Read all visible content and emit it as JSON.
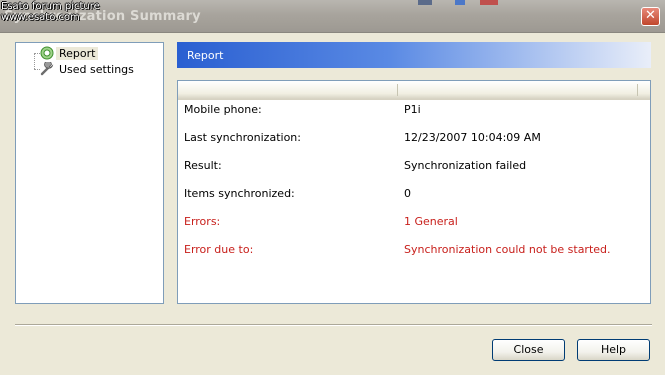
{
  "window": {
    "title": "Synchronization Summary",
    "watermark_line1": "Esato forum picture",
    "watermark_line2": "www.esato.com",
    "close_glyph": "✕"
  },
  "nav": {
    "items": [
      {
        "label": "Report",
        "icon": "report-status-icon",
        "selected": true
      },
      {
        "label": "Used settings",
        "icon": "wrench-icon",
        "selected": false
      }
    ]
  },
  "report": {
    "header": "Report",
    "columns": [
      "",
      ""
    ],
    "rows": [
      {
        "label": "Mobile phone:",
        "value": "P1i",
        "error": false
      },
      {
        "label": "Last synchronization:",
        "value": "12/23/2007 10:04:09 AM",
        "error": false
      },
      {
        "label": "Result:",
        "value": "Synchronization failed",
        "error": false
      },
      {
        "label": "Items synchronized:",
        "value": "0",
        "error": false
      },
      {
        "label": "Errors:",
        "value": "1 General",
        "error": true
      },
      {
        "label": "Error due to:",
        "value": "Synchronization could not be started.",
        "error": true
      }
    ]
  },
  "buttons": {
    "close_label": "Close",
    "help_label": "Help"
  },
  "colors": {
    "error_text": "#c8201c",
    "header_blue": "#2a5fd1"
  }
}
